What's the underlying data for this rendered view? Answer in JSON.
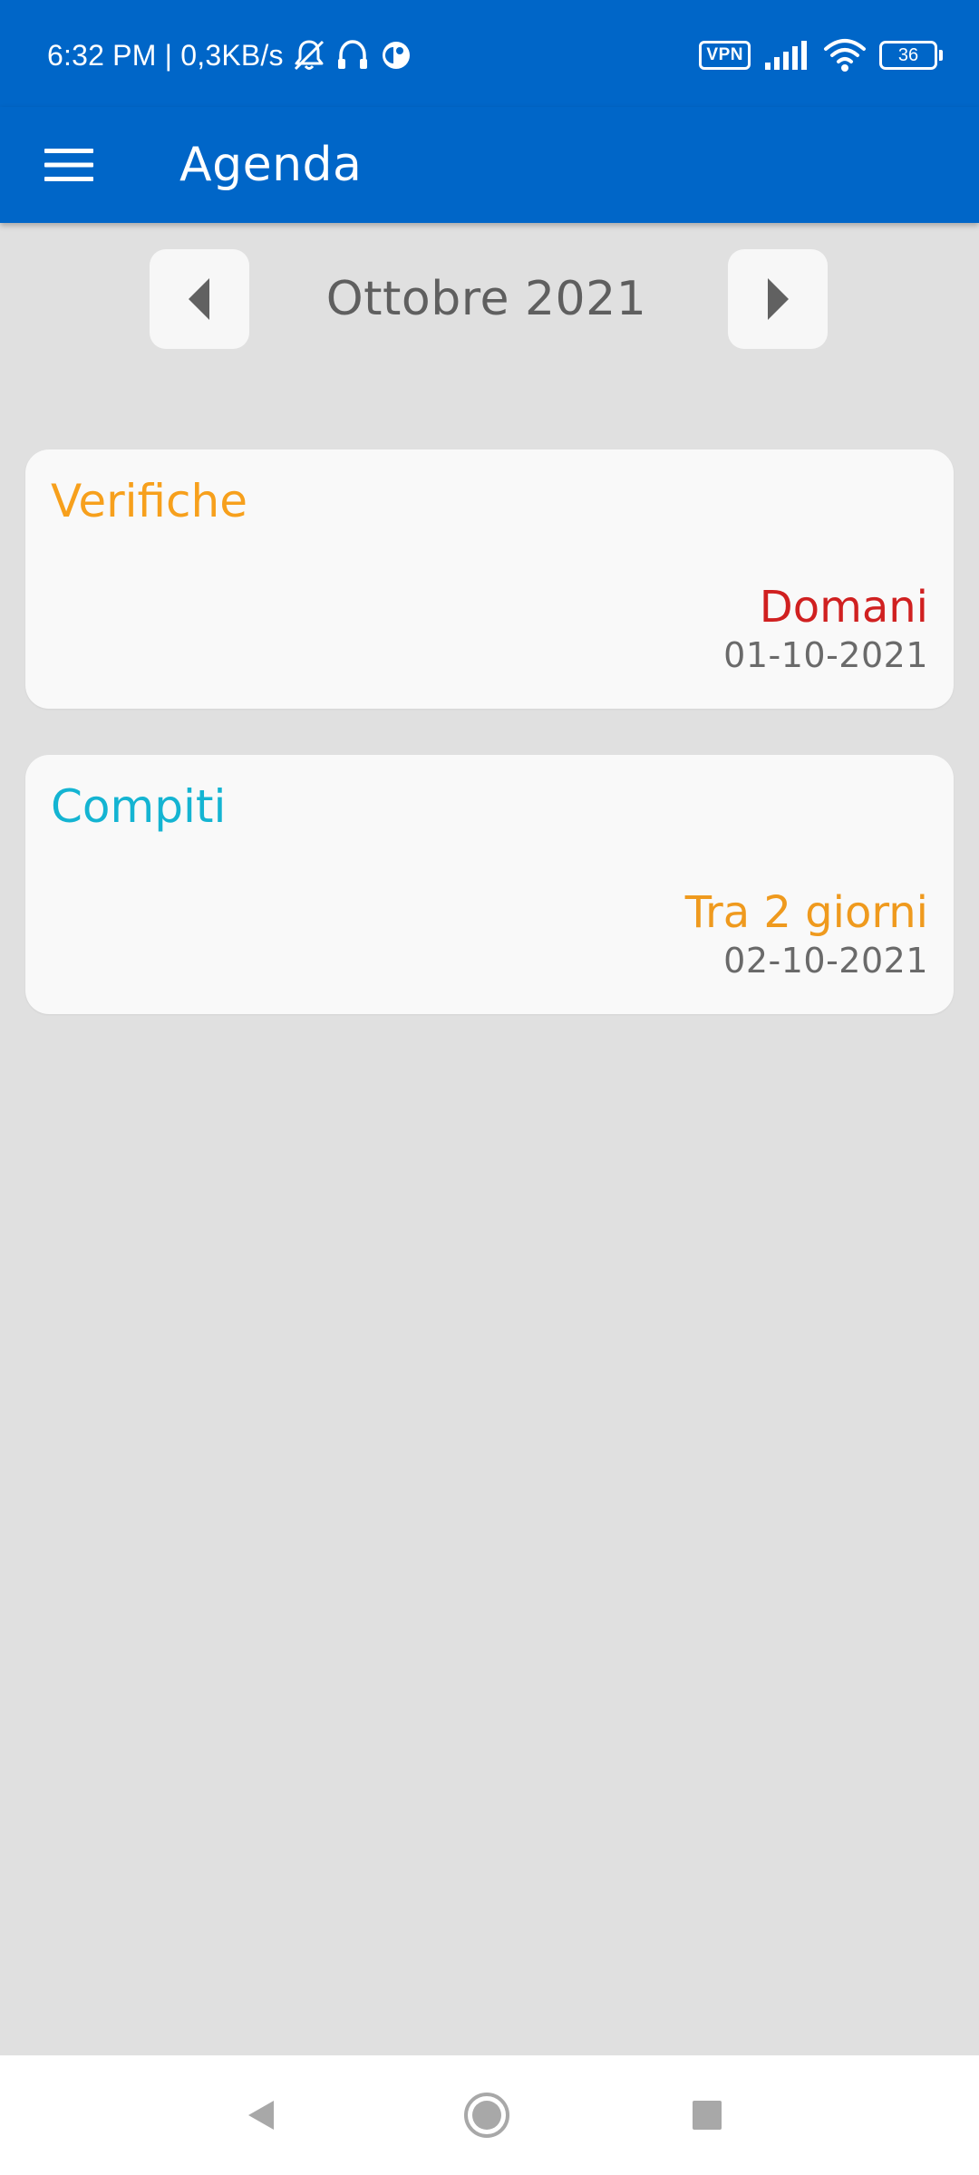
{
  "status_bar": {
    "time_and_speed": "6:32 PM | 0,3KB/s",
    "vpn_label": "VPN",
    "battery_level": "36",
    "icons": [
      "bell-off-icon",
      "headset-icon",
      "app-notification-icon",
      "vpn-icon",
      "signal-icon",
      "wifi-icon",
      "battery-icon"
    ]
  },
  "app_bar": {
    "title": "Agenda",
    "background_color": "#0066c8",
    "menu_icon": "hamburger-menu-icon"
  },
  "month_nav": {
    "label": "Ottobre 2021",
    "prev_icon": "triangle-left-icon",
    "next_icon": "triangle-right-icon"
  },
  "cards": [
    {
      "title": "Verifiche",
      "title_color": "#f7a01c",
      "when": "Domani",
      "when_color": "#d02020",
      "date": "01-10-2021"
    },
    {
      "title": "Compiti",
      "title_color": "#14b4d2",
      "when": "Tra 2 giorni",
      "when_color": "#ef9a1e",
      "date": "02-10-2021"
    }
  ],
  "nav_bar": {
    "icons": [
      "back-icon",
      "home-icon",
      "recents-icon"
    ]
  }
}
